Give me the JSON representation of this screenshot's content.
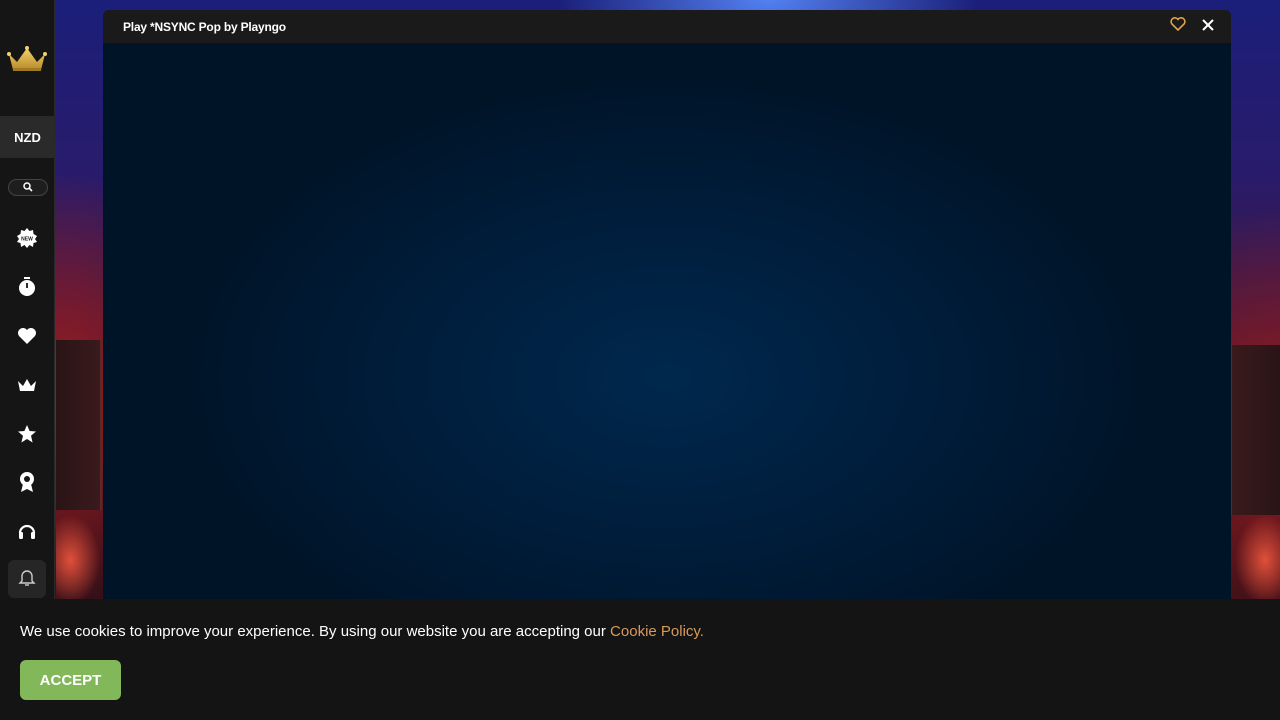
{
  "game": {
    "title": "Play *NSYNC Pop by Playngo"
  },
  "sidebar": {
    "currency": "NZD",
    "icons": [
      "crown-logo-icon",
      "search-icon",
      "new-badge-icon",
      "stopwatch-icon",
      "heart-icon",
      "crown-icon",
      "star-icon",
      "award-icon",
      "headset-icon",
      "bell-icon"
    ]
  },
  "cookie": {
    "text": "We use cookies to improve your experience. By using our website you are accepting our",
    "link": "Cookie Policy.",
    "accept_label": "ACCEPT"
  },
  "colors": {
    "accent_gold": "#d99a5a",
    "accept_green": "#83b85a",
    "sidebar_bg": "#151515"
  }
}
